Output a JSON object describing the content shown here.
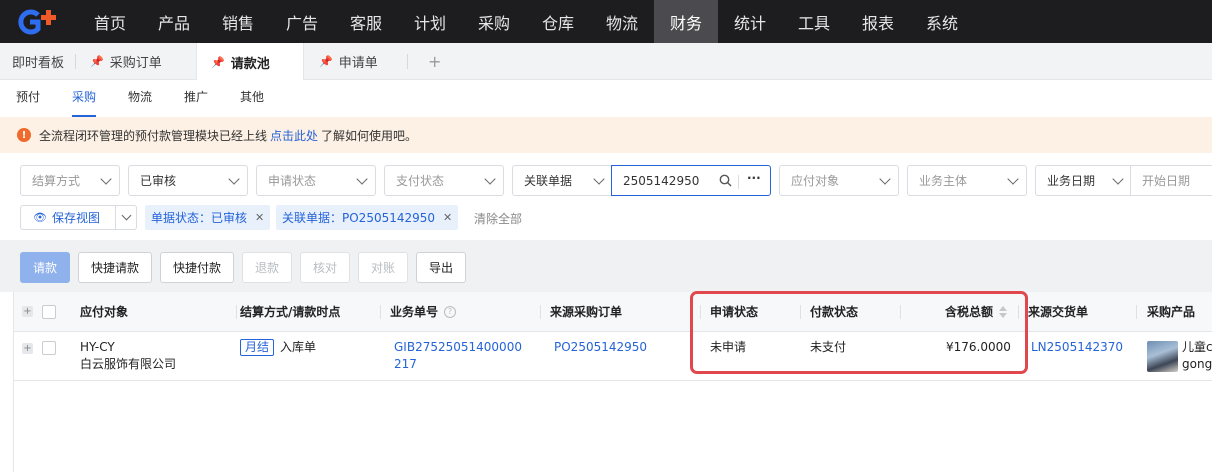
{
  "topnav": {
    "logo": "G+",
    "items": [
      "首页",
      "产品",
      "销售",
      "广告",
      "客服",
      "计划",
      "采购",
      "仓库",
      "物流",
      "财务",
      "统计",
      "工具",
      "报表",
      "系统"
    ],
    "active": "财务"
  },
  "tabs": {
    "items": [
      {
        "label": "即时看板"
      },
      {
        "label": "采购订单"
      },
      {
        "label": "请款池"
      },
      {
        "label": "申请单"
      }
    ],
    "add": "+"
  },
  "subtabs": [
    "预付",
    "采购",
    "物流",
    "推广",
    "其他"
  ],
  "notice": {
    "text_before": "全流程闭环管理的预付款管理模块已经上线",
    "link": "点击此处",
    "text_after": "了解如何使用吧。"
  },
  "filters": {
    "settlement": "结算方式",
    "review_status": "已审核",
    "apply_status": "申请状态",
    "pay_status": "支付状态",
    "related_doc": "关联单据",
    "search_value": "2505142950",
    "more": "···",
    "payable_object": "应付对象",
    "business_entity": "业务主体",
    "business_date": "业务日期",
    "start_date": "开始日期"
  },
  "chips": {
    "save_view": "保存视图",
    "chip1": "单据状态：已审核",
    "chip2": "关联单据：PO2505142950",
    "clear": "清除全部"
  },
  "toolbar": {
    "request": "请款",
    "quick_request": "快捷请款",
    "quick_pay": "快捷付款",
    "refund": "退款",
    "verify": "核对",
    "reconcile": "对账",
    "export": "导出"
  },
  "table": {
    "headers": [
      "应付对象",
      "结算方式/请款时点",
      "业务单号",
      "来源采购订单",
      "申请状态",
      "付款状态",
      "含税总额",
      "来源交货单",
      "采购产品"
    ],
    "row": {
      "payable_code": "HY-CY",
      "payable_name": "白云服饰有限公司",
      "settle_tag": "月结",
      "settle_point": "入库单",
      "biz_no_line1": "GIB27525051400000",
      "biz_no_line2": "217",
      "source_po": "PO2505142950",
      "apply_status": "未申请",
      "pay_status": "未支付",
      "total": "¥176.0000",
      "delivery_no": "LN2505142370",
      "product_line1": "儿童c",
      "product_line2": "gong"
    }
  },
  "colors": {
    "accent": "#2563d8",
    "nav_bg": "#1d1d1f",
    "highlight": "#e0484d",
    "notice_bg": "#fdf0e4"
  }
}
